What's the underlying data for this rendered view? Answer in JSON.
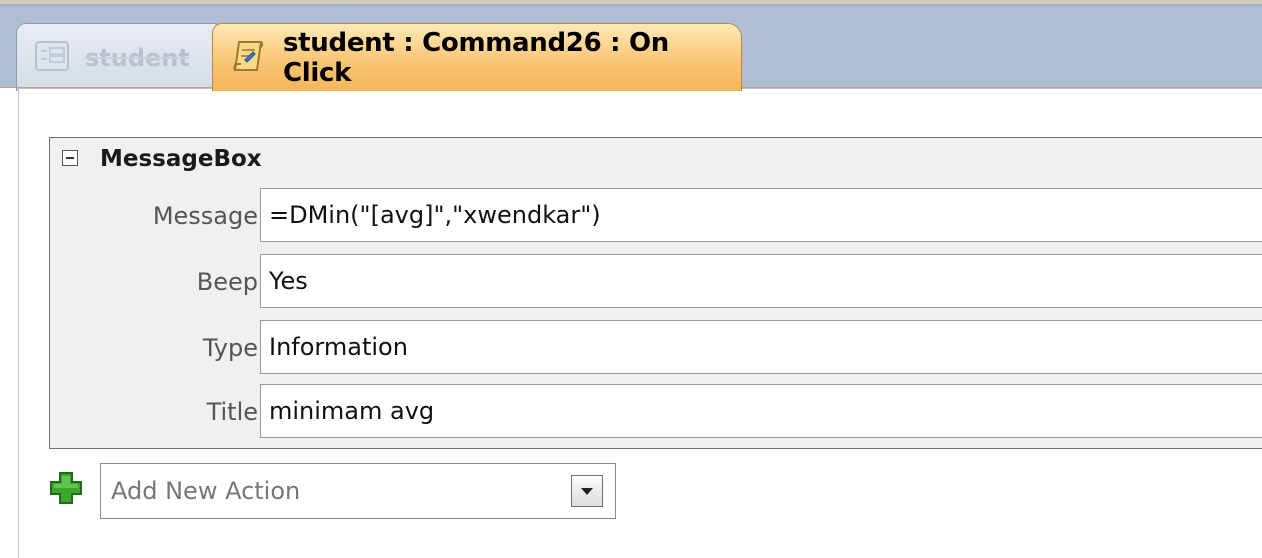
{
  "tabs": [
    {
      "label": "student",
      "icon": "form-icon",
      "active": false
    },
    {
      "label": "student : Command26 : On Click",
      "icon": "macro-scroll-icon",
      "active": true
    }
  ],
  "action": {
    "name": "MessageBox",
    "arguments": [
      {
        "label": "Message",
        "value": "=DMin(\"[avg]\",\"xwendkar\")"
      },
      {
        "label": "Beep",
        "value": "Yes"
      },
      {
        "label": "Type",
        "value": "Information"
      },
      {
        "label": "Title",
        "value": "minimam avg"
      }
    ]
  },
  "add_action": {
    "placeholder": "Add New Action",
    "icon": "green-plus-icon",
    "dropdown_icon": "chevron-down-icon"
  },
  "colors": {
    "tab_active": "#f8c470",
    "tabbar_bg": "#aebfd5",
    "block_bg": "#f0f0f0",
    "plus_green": "#3aa82c"
  }
}
